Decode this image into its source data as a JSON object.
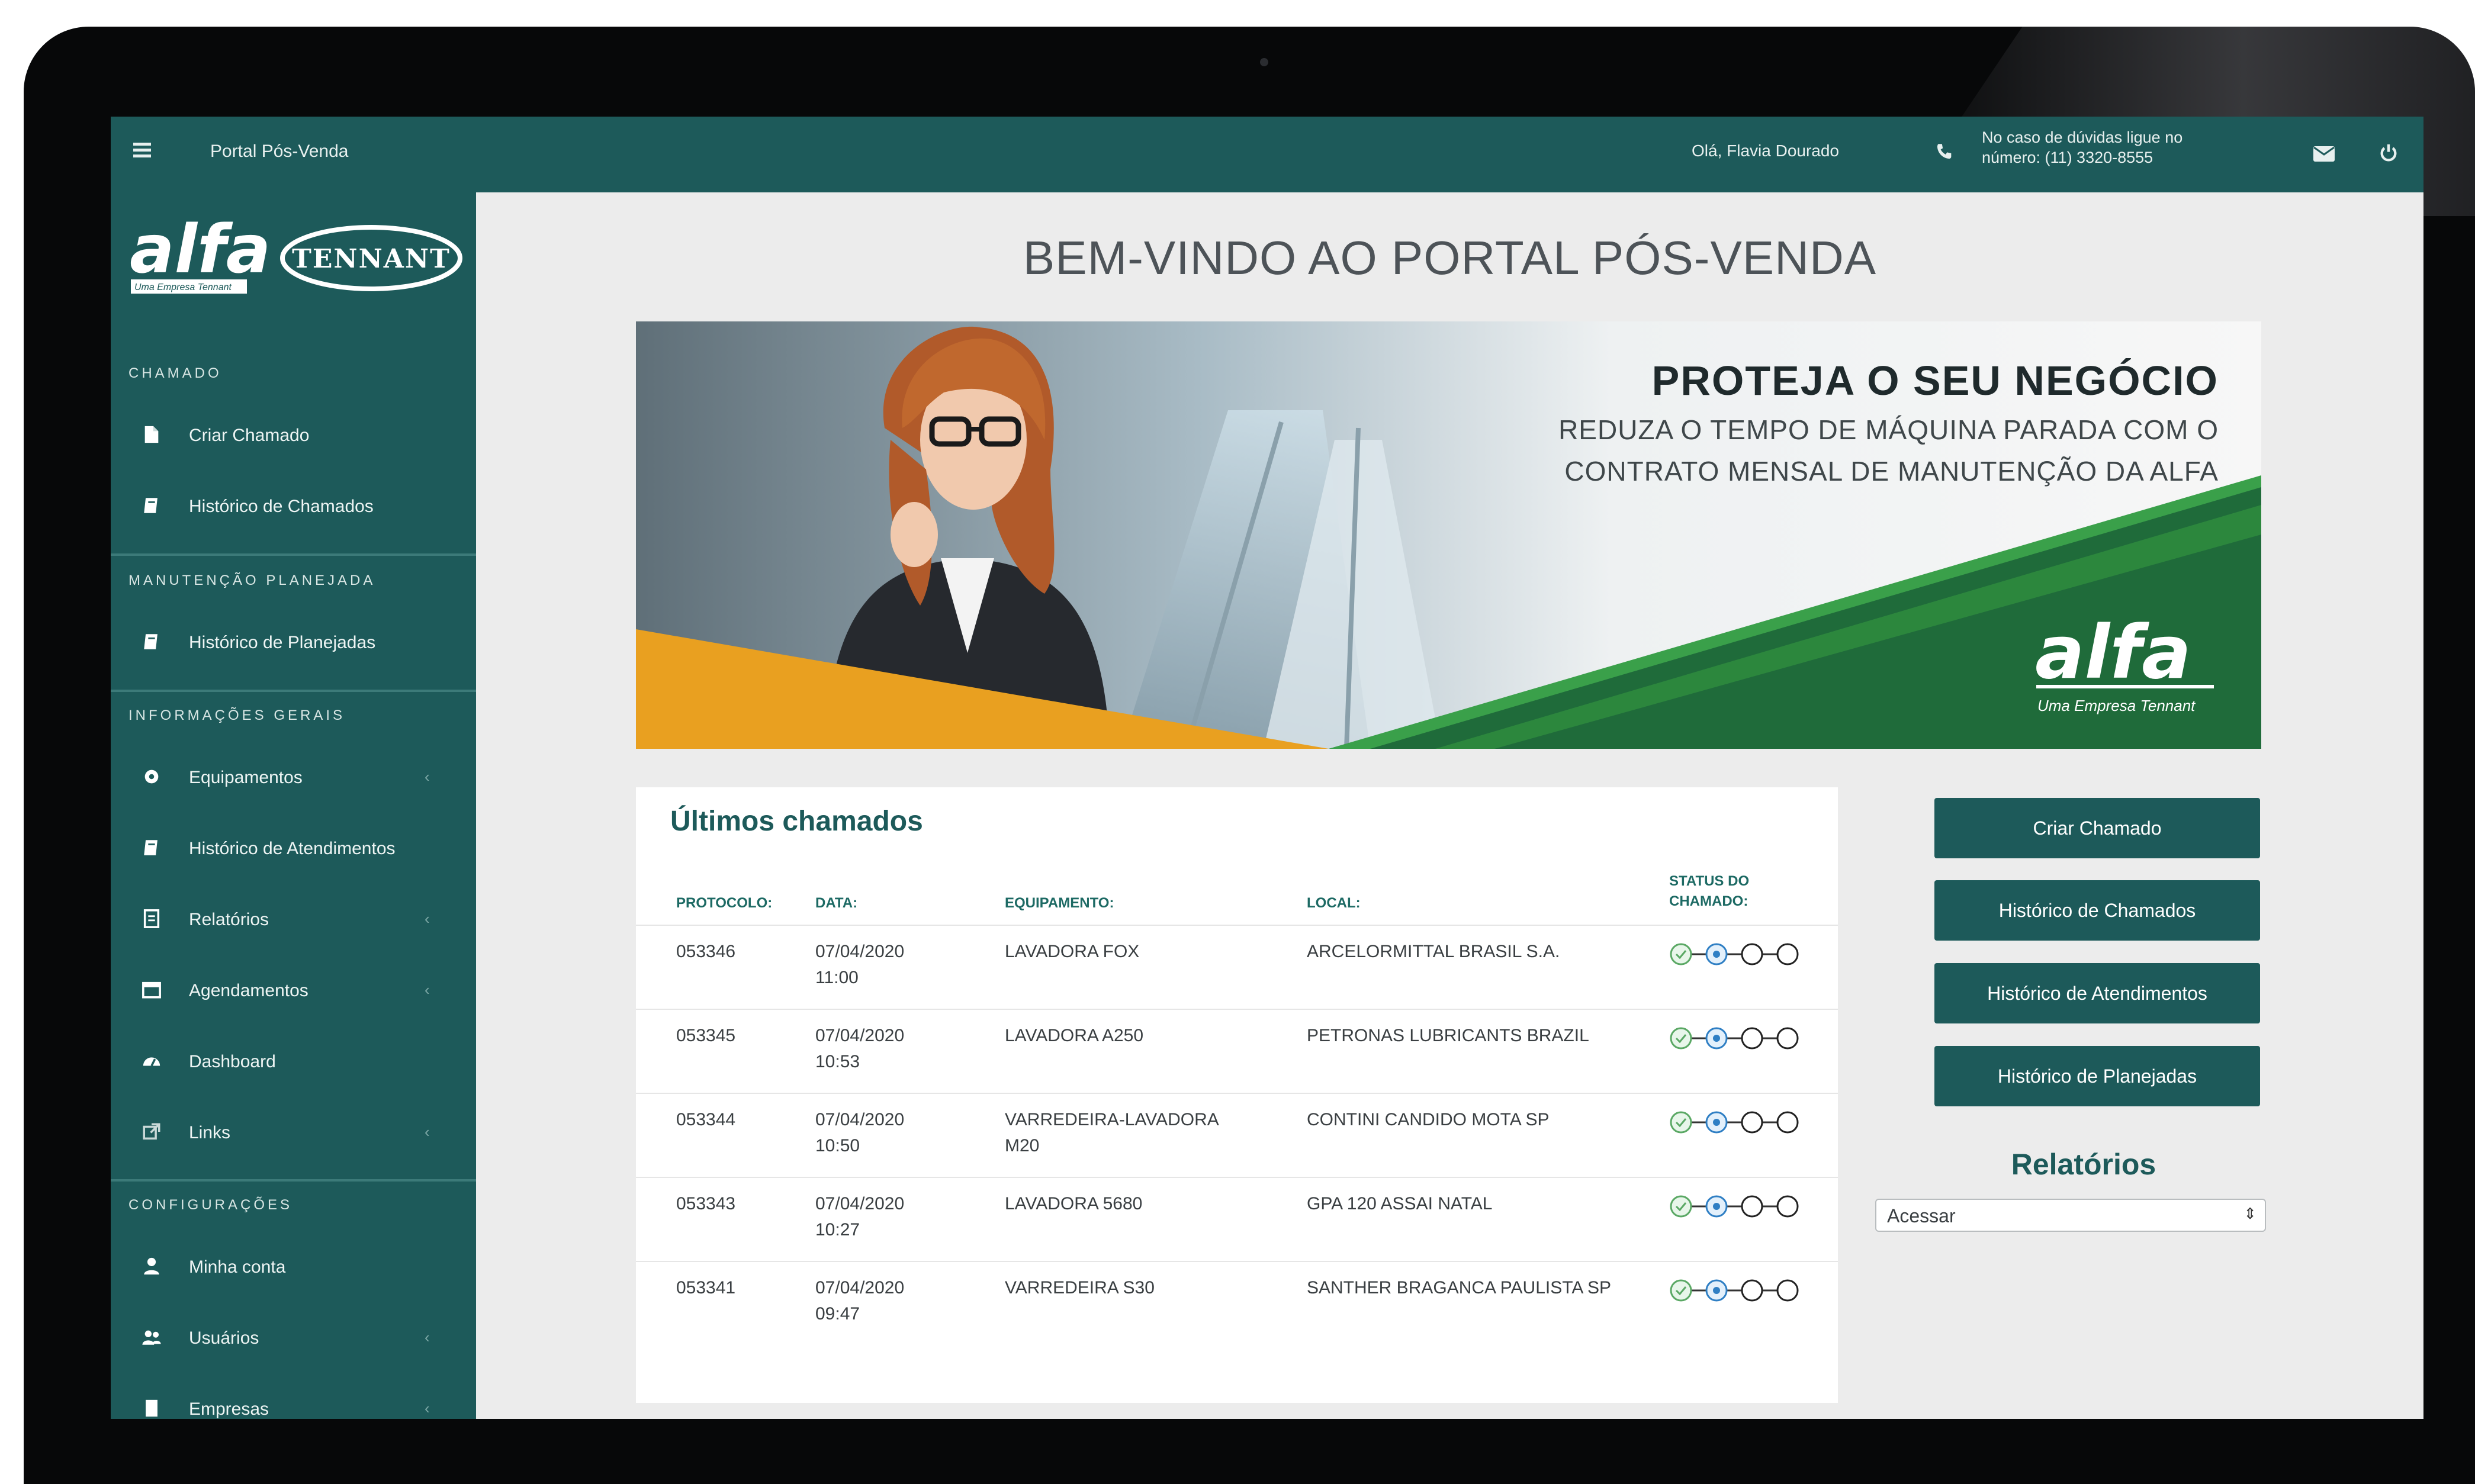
{
  "topbar": {
    "menu_icon": "hamburger-icon",
    "title": "Portal Pós-Venda",
    "greeting": "Olá, Flavia Dourado",
    "help_line1": "No caso de dúvidas ligue no",
    "help_line2": "número: (11) 3320-8555",
    "icons": [
      "phone-icon",
      "mail-icon",
      "power-icon"
    ]
  },
  "sidebar": {
    "logo_primary": "alfa",
    "logo_tagline": "Uma Empresa Tennant",
    "logo_secondary": "TENNANT",
    "sections": [
      {
        "title": "CHAMADO",
        "items": [
          {
            "label": "Criar Chamado",
            "icon": "file-icon"
          },
          {
            "label": "Histórico de Chamados",
            "icon": "book-icon"
          }
        ]
      },
      {
        "title": "MANUTENÇÃO PLANEJADA",
        "items": [
          {
            "label": "Histórico de Planejadas",
            "icon": "book-icon"
          }
        ]
      },
      {
        "title": "INFORMAÇÕES GERAIS",
        "items": [
          {
            "label": "Equipamentos",
            "icon": "gear-icon",
            "chevron": "‹"
          },
          {
            "label": "Histórico de Atendimentos",
            "icon": "book-icon"
          },
          {
            "label": "Relatórios",
            "icon": "report-icon",
            "chevron": "‹"
          },
          {
            "label": "Agendamentos",
            "icon": "calendar-icon",
            "chevron": "‹"
          },
          {
            "label": "Dashboard",
            "icon": "dashboard-icon"
          },
          {
            "label": "Links",
            "icon": "external-link-icon",
            "chevron": "‹"
          }
        ]
      },
      {
        "title": "CONFIGURAÇÕES",
        "items": [
          {
            "label": "Minha conta",
            "icon": "user-icon"
          },
          {
            "label": "Usuários",
            "icon": "users-icon",
            "chevron": "‹"
          },
          {
            "label": "Empresas",
            "icon": "building-icon",
            "chevron": "‹"
          }
        ]
      }
    ]
  },
  "main": {
    "title": "BEM-VINDO AO PORTAL PÓS-VENDA",
    "banner": {
      "headline": "PROTEJA O SEU NEGÓCIO",
      "sub_line1": "REDUZA O TEMPO  DE MÁQUINA PARADA COM O",
      "sub_line2": "CONTRATO MENSAL DE MANUTENÇÃO DA ALFA",
      "logo": "alfa",
      "logo_tagline": "Uma Empresa Tennant",
      "colors": {
        "green": "#1f6b3a",
        "green_light": "#2e8b3e",
        "orange": "#e9a020"
      }
    },
    "calls": {
      "title": "Últimos chamados",
      "headers": {
        "protocol": "PROTOCOLO:",
        "date": "DATA:",
        "equipment": "EQUIPAMENTO:",
        "location": "LOCAL:",
        "status_line1": "STATUS DO",
        "status_line2": "CHAMADO:"
      },
      "rows": [
        {
          "protocol": "053346",
          "date": "07/04/2020",
          "time": "11:00",
          "equipment": "LAVADORA FOX",
          "equipment2": "",
          "location": "ARCELORMITTAL BRASIL S.A."
        },
        {
          "protocol": "053345",
          "date": "07/04/2020",
          "time": "10:53",
          "equipment": "LAVADORA A250",
          "equipment2": "",
          "location": "PETRONAS LUBRICANTS BRAZIL"
        },
        {
          "protocol": "053344",
          "date": "07/04/2020",
          "time": "10:50",
          "equipment": "VARREDEIRA-LAVADORA",
          "equipment2": "M20",
          "location": "CONTINI CANDIDO MOTA SP"
        },
        {
          "protocol": "053343",
          "date": "07/04/2020",
          "time": "10:27",
          "equipment": "LAVADORA 5680",
          "equipment2": "",
          "location": "GPA 120 ASSAI NATAL"
        },
        {
          "protocol": "053341",
          "date": "07/04/2020",
          "time": "09:47",
          "equipment": "VARREDEIRA S30",
          "equipment2": "",
          "location": "SANTHER BRAGANCA PAULISTA SP"
        }
      ],
      "status_steps": [
        "done",
        "in-progress",
        "pending",
        "pending"
      ]
    },
    "actions": {
      "create": "Criar Chamado",
      "history_calls": "Histórico de Chamados",
      "history_service": "Histórico de Atendimentos",
      "history_planned": "Histórico de Planejadas"
    },
    "reports": {
      "title": "Relatórios",
      "select_value": "Acessar"
    }
  },
  "colors": {
    "primary": "#1d5a5a",
    "screen_bg": "#ececec"
  }
}
